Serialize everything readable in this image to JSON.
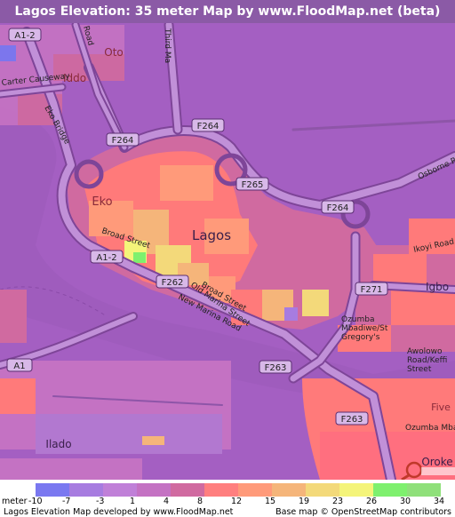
{
  "title": "Lagos Elevation: 35 meter Map by www.FloodMap.net (beta)",
  "colors": {
    "background": "#a45fc2",
    "water": "#9e5cbc",
    "header": "#8b5aa6",
    "road_casing": "#7e4598",
    "road_fill": "#c190d8",
    "city_core": "#ff7a7a",
    "pin": "#c0392b"
  },
  "places": {
    "lagos": "Lagos",
    "eko": "Eko",
    "iddo": "Iddo",
    "oto": "Oto",
    "ikoyi": "Ikoyi Road",
    "igbo": "Igbo",
    "ozumba": "Ozumba\nMbadiwe/St\nGregory's",
    "awolowo": "Awolowo\nRoad/Keffi\nStreet",
    "ilado": "Ilado",
    "oroke": "Oroke",
    "five": "Five",
    "ozumba_road": "Ozumba Mbadi"
  },
  "streets": {
    "broad1": "Broad Street",
    "broad2": "Broad Street",
    "old_marina": "Old Marina Street",
    "new_marina": "New Marina Road",
    "eko_bridge": "Eko Bridge",
    "causeway": "Carter Causeway",
    "third_mainland": "Third Ma",
    "road": "Road",
    "osborne": "Osborne Road"
  },
  "shields": {
    "a1_2_top": "A1-2",
    "a1_2_mid": "A1-2",
    "a1": "A1",
    "f264_left": "F264",
    "f264_mid": "F264",
    "f264_right": "F264",
    "f265": "F265",
    "f262": "F262",
    "f263_mid": "F263",
    "f263_low": "F263",
    "f271": "F271"
  },
  "legend": {
    "unit_label": "meter",
    "ticks": [
      "-10",
      "-7",
      "-3",
      "1",
      "4",
      "8",
      "12",
      "15",
      "19",
      "23",
      "26",
      "30",
      "34"
    ],
    "colors": [
      "#78c7c0",
      "#7a78f0",
      "#a77ce0",
      "#c080d8",
      "#c472c3",
      "#d06aa0",
      "#ff7f7f",
      "#ff9a7a",
      "#f5b57a",
      "#f3d97a",
      "#f4f47a",
      "#7ef06e",
      "#8fe07a"
    ]
  },
  "footer": {
    "left": "Lagos Elevation Map developed by www.FloodMap.net",
    "right": "Base map © OpenStreetMap contributors"
  }
}
